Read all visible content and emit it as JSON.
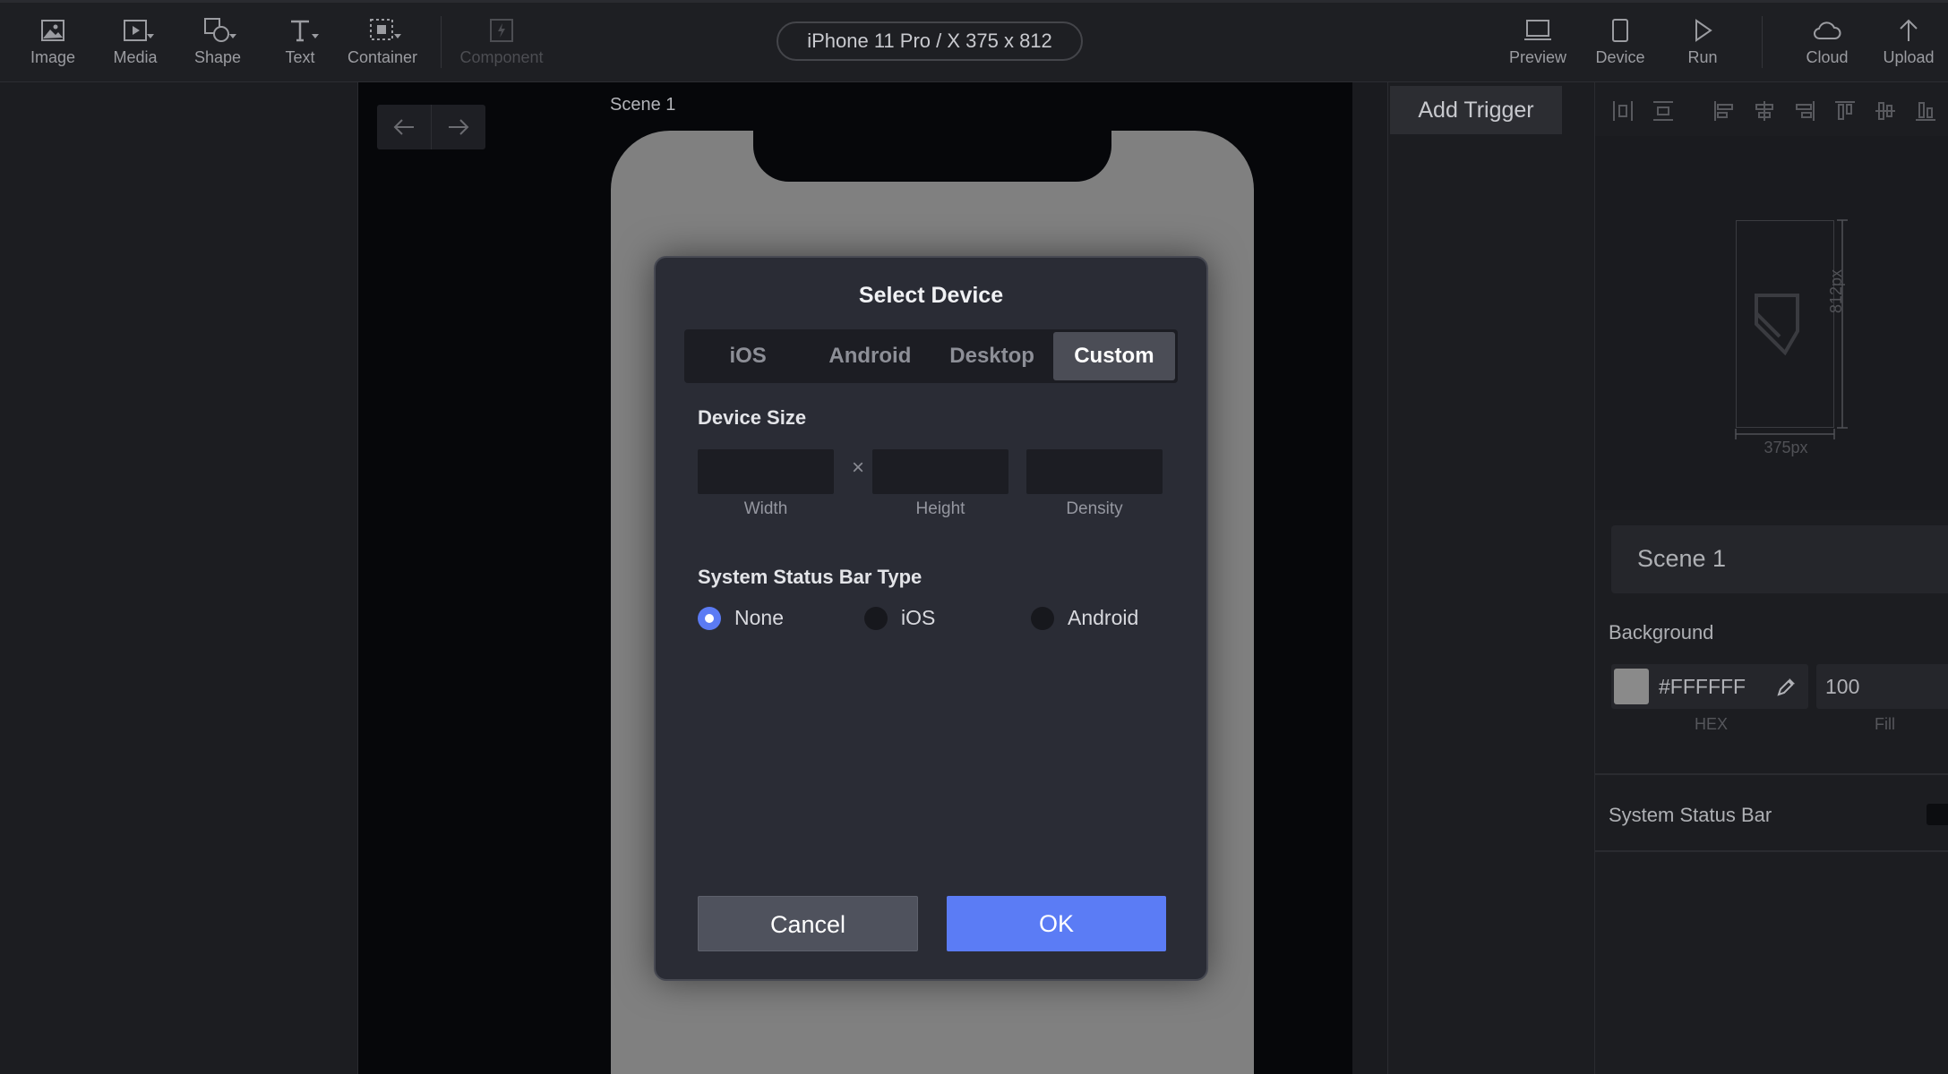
{
  "toolbar": {
    "items": [
      {
        "label": "Image",
        "icon": "image-icon"
      },
      {
        "label": "Media",
        "icon": "media-play-icon"
      },
      {
        "label": "Shape",
        "icon": "shape-icon"
      },
      {
        "label": "Text",
        "icon": "text-icon"
      },
      {
        "label": "Container",
        "icon": "container-icon"
      },
      {
        "label": "Component",
        "icon": "component-icon",
        "disabled": true
      }
    ],
    "device_selector": "iPhone 11 Pro / X  375 x 812",
    "right_items": [
      {
        "label": "Preview",
        "icon": "preview-laptop-icon"
      },
      {
        "label": "Device",
        "icon": "device-phone-icon"
      },
      {
        "label": "Run",
        "icon": "run-play-icon"
      },
      {
        "label": "Cloud",
        "icon": "cloud-icon"
      },
      {
        "label": "Upload",
        "icon": "upload-arrow-icon"
      }
    ]
  },
  "canvas": {
    "scene_label": "Scene 1"
  },
  "trigger_panel": {
    "add_trigger": "Add Trigger"
  },
  "properties": {
    "preview_width": "375px",
    "preview_height": "812px",
    "scene_name": "Scene 1",
    "background_label": "Background",
    "hex_value": "#FFFFFF",
    "hex_label": "HEX",
    "fill_value": "100",
    "fill_label": "Fill",
    "status_bar_label": "System Status Bar"
  },
  "dialog": {
    "title": "Select Device",
    "tabs": [
      {
        "label": "iOS",
        "active": false
      },
      {
        "label": "Android",
        "active": false
      },
      {
        "label": "Desktop",
        "active": false
      },
      {
        "label": "Custom",
        "active": true
      }
    ],
    "device_size_title": "Device Size",
    "width_label": "Width",
    "height_label": "Height",
    "density_label": "Density",
    "times_symbol": "×",
    "status_bar_title": "System Status Bar Type",
    "status_options": [
      {
        "label": "None",
        "selected": true
      },
      {
        "label": "iOS",
        "selected": false
      },
      {
        "label": "Android",
        "selected": false
      }
    ],
    "cancel_label": "Cancel",
    "ok_label": "OK"
  },
  "colors": {
    "accent": "#5b7cf5",
    "background": "#1c1d21",
    "canvas": "#06070a",
    "phone": "#808080"
  }
}
